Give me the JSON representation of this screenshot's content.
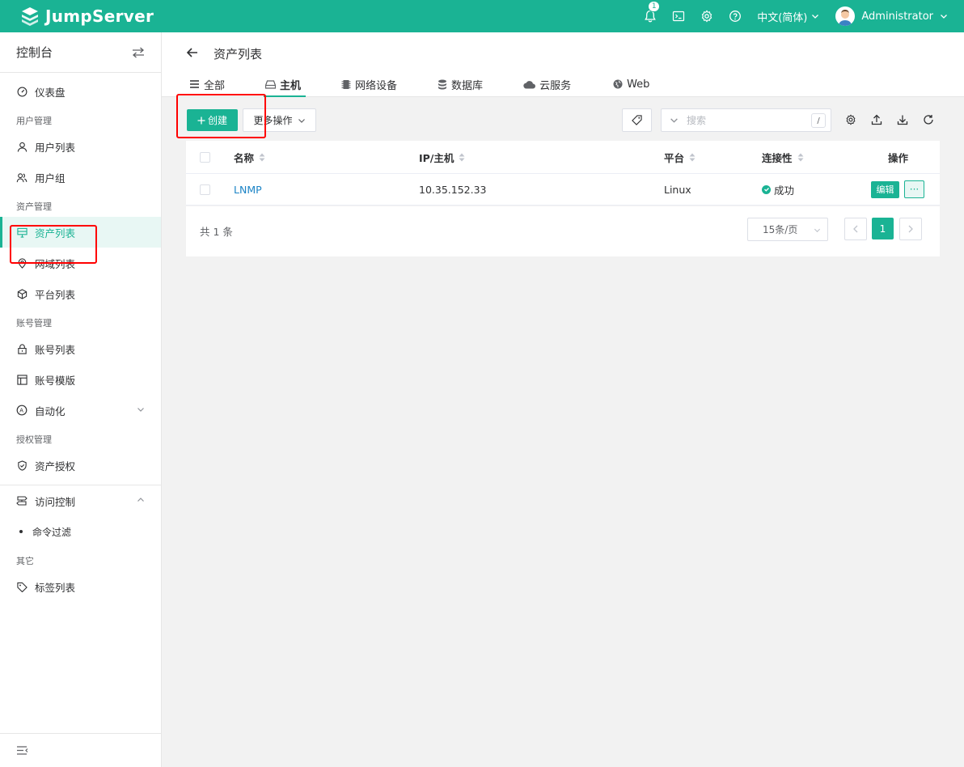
{
  "app": {
    "name": "JumpServer"
  },
  "topbar": {
    "notification_count": "1",
    "language": "中文(简体)",
    "user_name": "Administrator",
    "icons": [
      "bell-icon",
      "terminal-icon",
      "settings-icon",
      "help-icon"
    ]
  },
  "sidebar": {
    "title": "控制台",
    "dashboard": "仪表盘",
    "groups": {
      "users": "用户管理",
      "assets": "资产管理",
      "accounts": "账号管理",
      "perms": "授权管理",
      "other": "其它"
    },
    "items": {
      "user_list": "用户列表",
      "user_group": "用户组",
      "asset_list": "资产列表",
      "domain_list": "网域列表",
      "platform_list": "平台列表",
      "account_list": "账号列表",
      "account_template": "账号模版",
      "automation": "自动化",
      "asset_permission": "资产授权",
      "access_control": "访问控制",
      "command_filter": "命令过滤",
      "label_list": "标签列表"
    }
  },
  "page": {
    "title": "资产列表",
    "tabs": [
      {
        "label": "全部",
        "icon": "list-icon"
      },
      {
        "label": "主机",
        "icon": "host-icon",
        "active": true
      },
      {
        "label": "网络设备",
        "icon": "chip-icon"
      },
      {
        "label": "数据库",
        "icon": "database-icon"
      },
      {
        "label": "云服务",
        "icon": "cloud-icon"
      },
      {
        "label": "Web",
        "icon": "globe-icon"
      }
    ]
  },
  "toolbar": {
    "create_label": "创建",
    "more_label": "更多操作",
    "search_placeholder": "搜索",
    "search_shortcut": "/"
  },
  "table": {
    "columns": [
      "名称",
      "IP/主机",
      "平台",
      "连接性",
      "操作"
    ],
    "rows": [
      {
        "name": "LNMP",
        "ip": "10.35.152.33",
        "platform": "Linux",
        "connectivity": "成功",
        "edit": "编辑",
        "more": "···"
      }
    ]
  },
  "pagination": {
    "total": "共 1 条",
    "page_size": "15条/页",
    "current_page": "1"
  },
  "colors": {
    "brand": "#1ab394",
    "link": "#1c84c6",
    "highlight": "#ff0000"
  }
}
